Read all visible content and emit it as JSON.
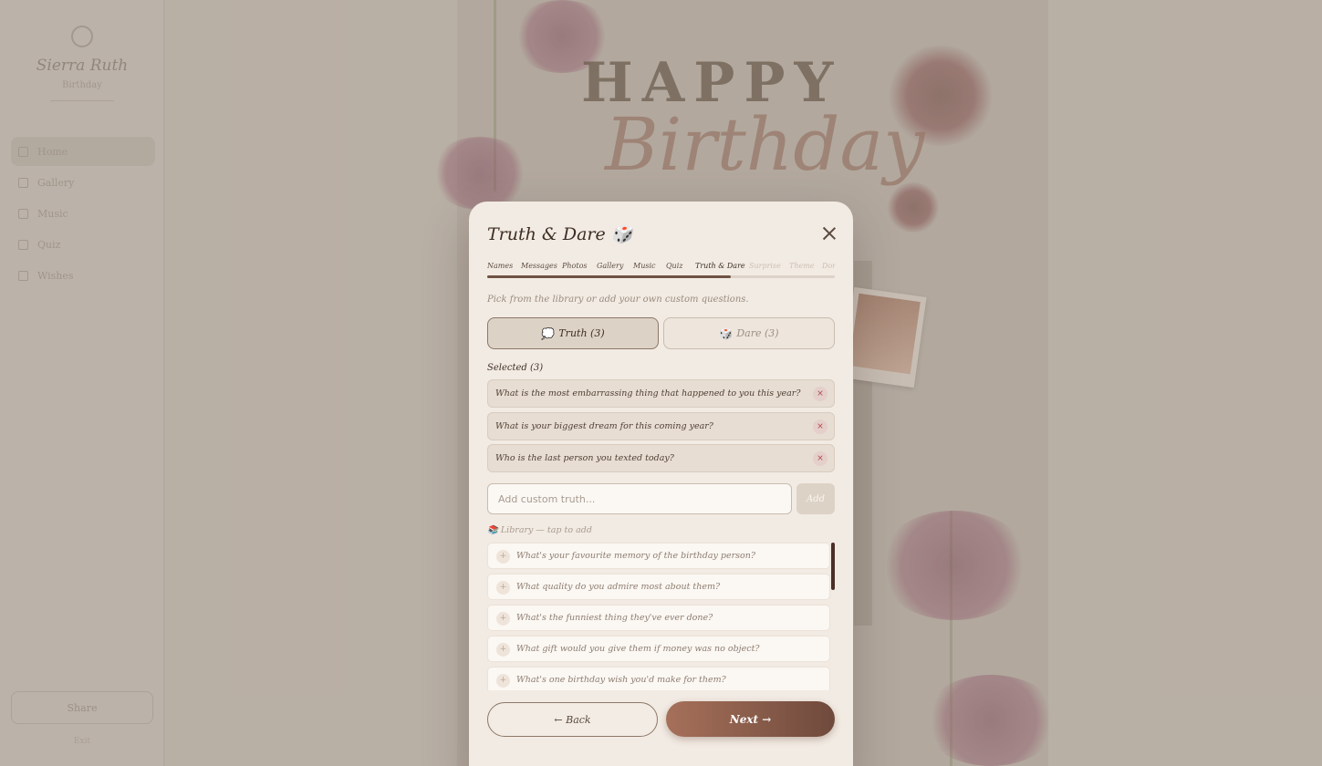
{
  "sidebar": {
    "title": "Sierra Ruth",
    "subtitle": "Birthday",
    "items": [
      {
        "label": "Home"
      },
      {
        "label": "Gallery"
      },
      {
        "label": "Music"
      },
      {
        "label": "Quiz"
      },
      {
        "label": "Wishes"
      }
    ],
    "bottom_button": "Share",
    "footer": "Exit"
  },
  "background": {
    "headline_1": "HAPPY",
    "headline_2": "Birthday"
  },
  "modal": {
    "title": "Truth & Dare 🎲",
    "steps": [
      "Names",
      "Messages",
      "Photos",
      "Gallery",
      "Music",
      "Quiz",
      "Truth & Dare",
      "Surprise",
      "Theme",
      "Done"
    ],
    "current_step": "Truth & Dare",
    "progress": 0.7,
    "hint": "Pick from the library or add your own custom questions.",
    "tabs": {
      "truth": {
        "emoji": "💭",
        "label": "Truth (3)"
      },
      "dare": {
        "emoji": "🎲",
        "label": "Dare (3)"
      }
    },
    "selected_label": "Selected (3)",
    "selected": [
      "What is the most embarrassing thing that happened to you this year?",
      "What is your biggest dream for this coming year?",
      "Who is the last person you texted today?"
    ],
    "remove_symbol": "×",
    "custom_input": {
      "value": "",
      "placeholder": "Add custom truth..."
    },
    "add_button": "Add",
    "library_label": "📚 Library — tap to add",
    "library": [
      "What's your favourite memory of the birthday person?",
      "What quality do you admire most about them?",
      "What's the funniest thing they've ever done?",
      "What gift would you give them if money was no object?",
      "What's one birthday wish you'd make for them?"
    ],
    "add_symbol": "+",
    "back_button": "← Back",
    "next_button": "Next →"
  },
  "colors": {
    "accent": "#6e5243",
    "next_gradient_start": "#a6705a",
    "next_gradient_end": "#6f4a3c",
    "remove": "#b04a4a"
  }
}
